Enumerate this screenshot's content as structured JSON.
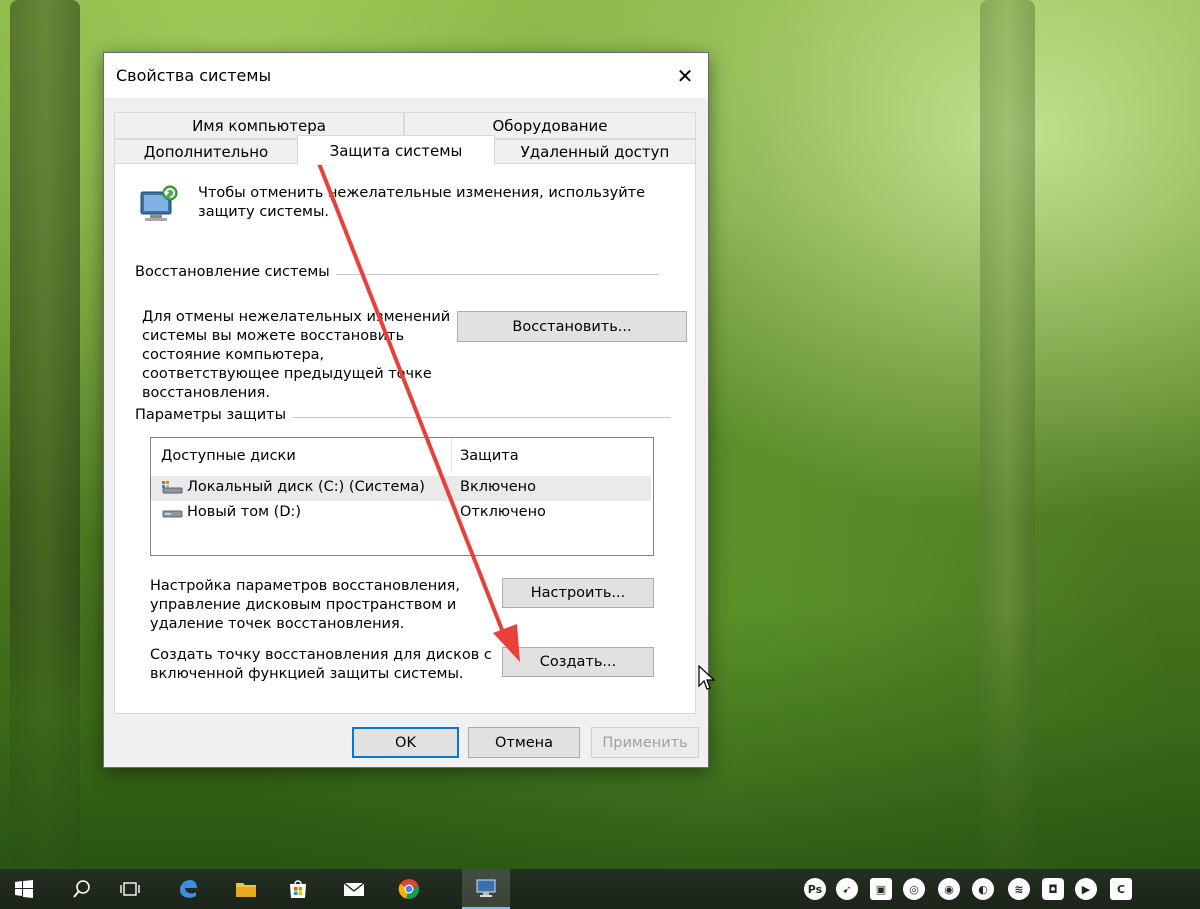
{
  "window": {
    "title": "Свойства системы",
    "close_glyph": "✕"
  },
  "tabs": {
    "row1": [
      "Имя компьютера",
      "Оборудование"
    ],
    "row2": [
      "Дополнительно",
      "Защита системы",
      "Удаленный доступ"
    ],
    "active": "Защита системы"
  },
  "intro": {
    "line1": "Чтобы отменить нежелательные изменения, используйте",
    "line2": "защиту системы.",
    "icon": "system-protection-monitor-icon"
  },
  "restore_group": {
    "title": "Восстановление системы",
    "desc": [
      "Для отмены нежелательных изменений",
      "системы вы можете восстановить",
      "состояние компьютера,",
      "соответствующее предыдущей точке",
      "восстановления."
    ],
    "button": "Восстановить..."
  },
  "protection_group": {
    "title": "Параметры защиты",
    "columns": [
      "Доступные диски",
      "Защита"
    ],
    "drives": [
      {
        "name": "Локальный диск (C:) (Система)",
        "status": "Включено",
        "icon": "system-drive-icon",
        "selected": true
      },
      {
        "name": "Новый том (D:)",
        "status": "Отключено",
        "icon": "drive-icon",
        "selected": false
      }
    ],
    "configure": {
      "desc": [
        "Настройка параметров восстановления,",
        "управление дисковым пространством и",
        "удаление точек восстановления."
      ],
      "button": "Настроить..."
    },
    "create": {
      "desc": [
        "Создать точку восстановления для дисков с",
        "включенной функцией защиты системы."
      ],
      "button": "Создать..."
    }
  },
  "footer": {
    "ok": "OK",
    "cancel": "Отмена",
    "apply": "Применить"
  },
  "annotation": {
    "color": "#e8413a"
  },
  "taskbar": {
    "icons": [
      "start-icon",
      "search-icon",
      "task-view-icon",
      "edge-icon",
      "file-explorer-icon",
      "store-icon",
      "mail-icon",
      "chrome-icon",
      "system-properties-icon"
    ],
    "tray": [
      "Ps",
      "➹",
      "▣",
      "◎",
      "◉",
      "◐",
      "≋",
      "◘",
      "▶",
      "C"
    ]
  }
}
